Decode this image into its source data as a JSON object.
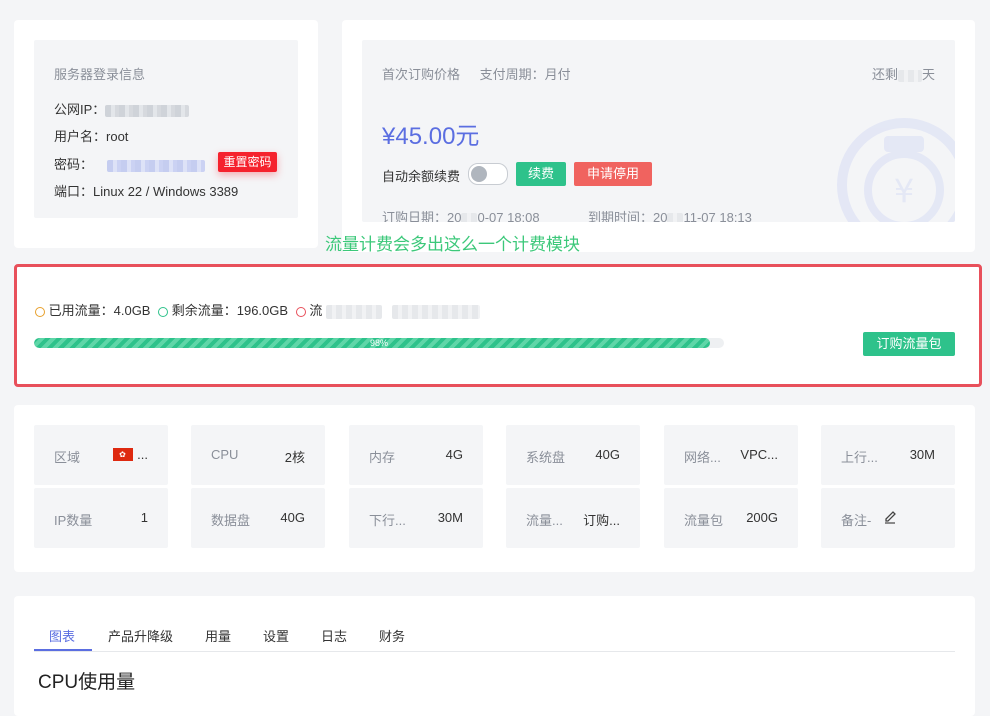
{
  "login": {
    "title": "服务器登录信息",
    "ip_label": "公网IP：",
    "user_label": "用户名：",
    "user_value": "root",
    "pwd_label": "密码：",
    "reset_button": "重置密码",
    "port_label": "端口：",
    "port_value": "Linux 22 / Windows 3389"
  },
  "billing": {
    "first_price_label": "首次订购价格",
    "period_label": "支付周期：月付",
    "remaining_label": "还剩",
    "remaining_suffix": "天",
    "price_prefix": "¥4",
    "price_suffix": "5.00元",
    "auto_renew_label": "自动余额续费",
    "renew_button": "续费",
    "cancel_button": "申请停用",
    "order_date_label": "订购日期：20",
    "order_date_suffix": "0-07 18:08",
    "expire_label": "到期时间：20",
    "expire_suffix": "11-07 18:13"
  },
  "annotation": "流量计费会多出这么一个计费模块",
  "traffic": {
    "used_label": "已用流量：4.0GB",
    "remain_label": "剩余流量：196.0GB",
    "third_label": "流",
    "percent_label": "98%",
    "percent_value": 0.98,
    "buy_button": "订购流量包"
  },
  "specs": {
    "row1": [
      {
        "k": "区域",
        "v": "..."
      },
      {
        "k": "CPU",
        "v": "2核"
      },
      {
        "k": "内存",
        "v": "4G"
      },
      {
        "k": "系统盘",
        "v": "40G"
      },
      {
        "k": "网络...",
        "v": "VPC..."
      },
      {
        "k": "上行...",
        "v": "30M"
      }
    ],
    "row2": [
      {
        "k": "IP数量",
        "v": "1"
      },
      {
        "k": "数据盘",
        "v": "40G"
      },
      {
        "k": "下行...",
        "v": "30M"
      },
      {
        "k": "流量...",
        "v": "订购..."
      },
      {
        "k": "流量包",
        "v": "200G"
      },
      {
        "k": "备注-",
        "v": ""
      }
    ]
  },
  "tabs": [
    "图表",
    "产品升降级",
    "用量",
    "设置",
    "日志",
    "财务"
  ],
  "section_title": "CPU使用量",
  "colors": {
    "accent": "#5b6ee1",
    "green": "#2ec28b",
    "red": "#f0635f",
    "annotation": "#3cc87a",
    "highlight_border": "#e8505b"
  }
}
